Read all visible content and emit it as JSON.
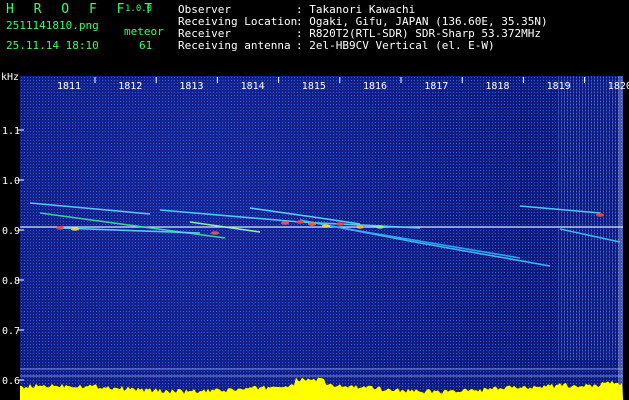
{
  "header": {
    "brand": "H R O F F T",
    "version": "1.0.0",
    "filename": "2511141810.png",
    "datetime": "25.11.14 18:10",
    "meteor_label": "meteor",
    "meteor_count": "61"
  },
  "meta": [
    {
      "key": "Observer",
      "value": ": Takanori Kawachi"
    },
    {
      "key": "Receiving Location",
      "value": ": Ogaki, Gifu, JAPAN (136.60E, 35.35N)"
    },
    {
      "key": "Receiver",
      "value": ": R820T2(RTL-SDR) SDR-Sharp 53.372MHz"
    },
    {
      "key": "Receiving antenna",
      "value": ": 2el-HB9CV Vertical (el. E-W)"
    }
  ],
  "chart_data": {
    "type": "heatmap",
    "ylabel": "kHz",
    "y_ticks": [
      "1.1",
      "1.0",
      "0.9",
      "0.8",
      "0.7",
      "0.6"
    ],
    "x_ticks": [
      "1811",
      "1812",
      "1813",
      "1814",
      "1815",
      "1816",
      "1817",
      "1818",
      "1819",
      "1820"
    ],
    "carrier_khz": 0.906
  },
  "colors": {
    "background": "#0c1a7a",
    "text_green": "#33ff66",
    "histogram": "#ffff00"
  }
}
